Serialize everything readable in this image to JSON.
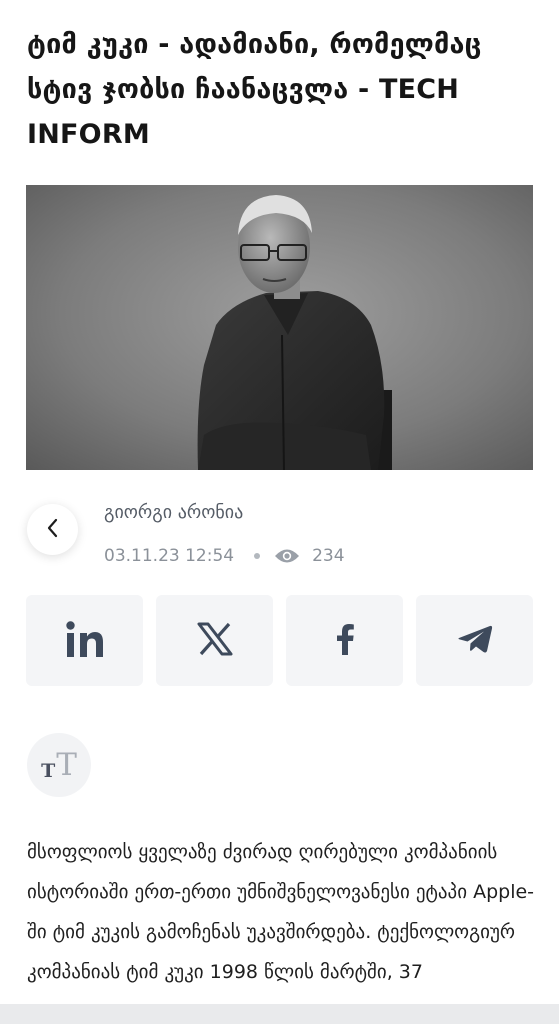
{
  "article": {
    "title": "ტიმ კუკი - ადამიანი, რომელმაც სტივ ჯობსი ჩაანაცვლა - TECH INFORM",
    "author": "გიორგი არონია",
    "date": "03.11.23 12:54",
    "views": "234",
    "body": "მსოფლიოს ყველაზე ძვირად ღირებული კომპანიის ისტორიაში ერთ-ერთი უმნიშვნელოვანესი ეტაპი Apple-ში ტიმ კუკის გამოჩენას უკავშირდება. ტექნოლოგიურ კომპანიას ტიმ კუკი 1998 წლის მარტში, 37"
  },
  "icons": {
    "back": "chevron-left-icon",
    "views": "eye-icon",
    "linkedin": "linkedin-icon",
    "x": "x-icon",
    "facebook": "facebook-icon",
    "telegram": "telegram-icon",
    "text_size": "text-size-icon"
  },
  "text_size": {
    "small": "T",
    "large": "T"
  },
  "colors": {
    "icon": "#3e4a5c",
    "tile": "#f4f5f7",
    "meta": "#8b9199"
  }
}
